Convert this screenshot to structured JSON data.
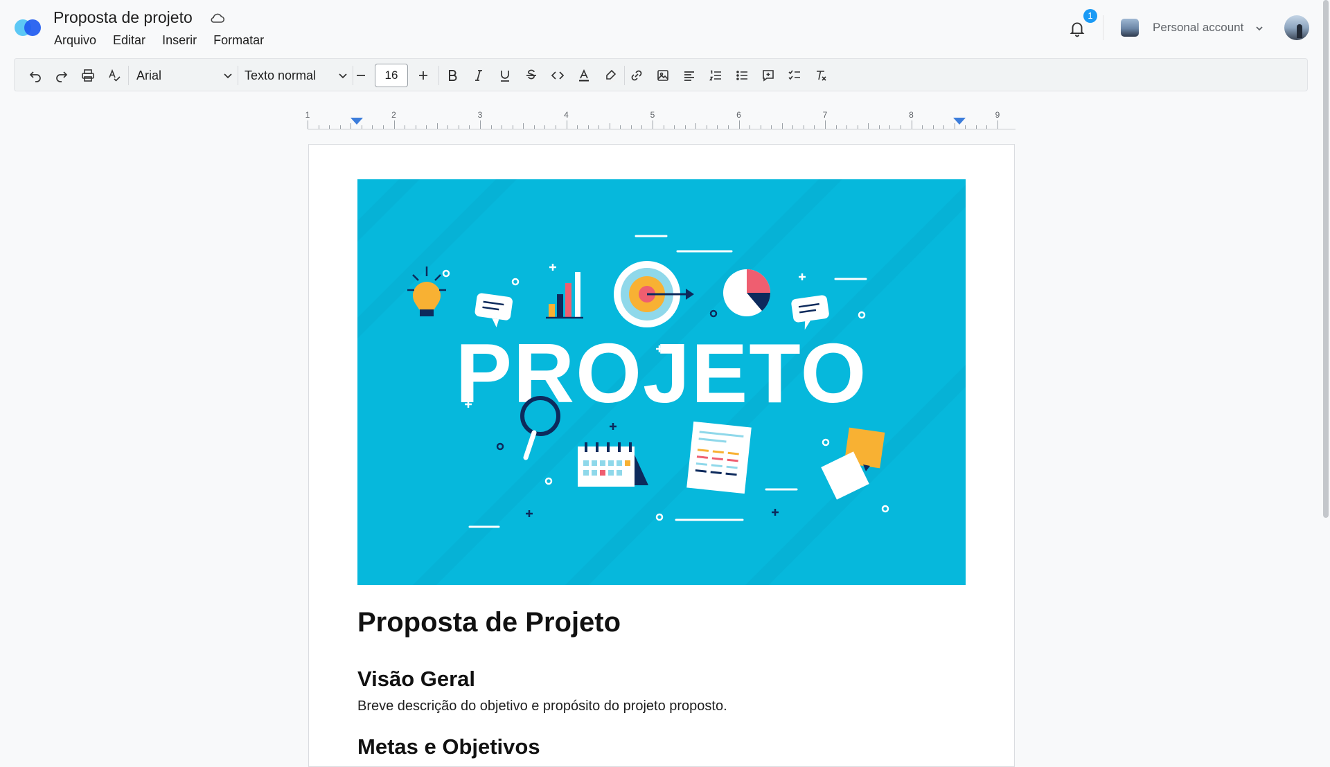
{
  "header": {
    "doc_title": "Proposta de projeto",
    "menu": [
      "Arquivo",
      "Editar",
      "Inserir",
      "Formatar"
    ],
    "notification_count": "1",
    "account_label": "Personal account"
  },
  "toolbar": {
    "font": "Arial",
    "style": "Texto normal",
    "font_size": "16"
  },
  "ruler": {
    "numbers": [
      "1",
      "2",
      "3",
      "4",
      "5",
      "6",
      "7",
      "8",
      "9"
    ]
  },
  "document": {
    "image_word": "PROJETO",
    "heading1": "Proposta de Projeto",
    "heading2": "Visão Geral",
    "paragraph": "Breve descrição do objetivo e propósito do projeto proposto.",
    "heading3": "Metas e Objetivos"
  },
  "colors": {
    "accent": "#1a9af5",
    "hero_bg": "#06b8dc",
    "hero_dark": "#0d2a5c"
  },
  "icons": [
    "logo-icon",
    "cloud-icon",
    "bell-icon",
    "chevron-down-icon",
    "undo-icon",
    "redo-icon",
    "print-icon",
    "spellcheck-icon",
    "minus-icon",
    "plus-icon",
    "bold-icon",
    "italic-icon",
    "underline-icon",
    "strikethrough-icon",
    "code-icon",
    "text-color-icon",
    "highlight-icon",
    "link-icon",
    "image-icon",
    "align-left-icon",
    "numbered-list-icon",
    "bullet-list-icon",
    "comment-icon",
    "checklist-icon",
    "clear-format-icon"
  ]
}
